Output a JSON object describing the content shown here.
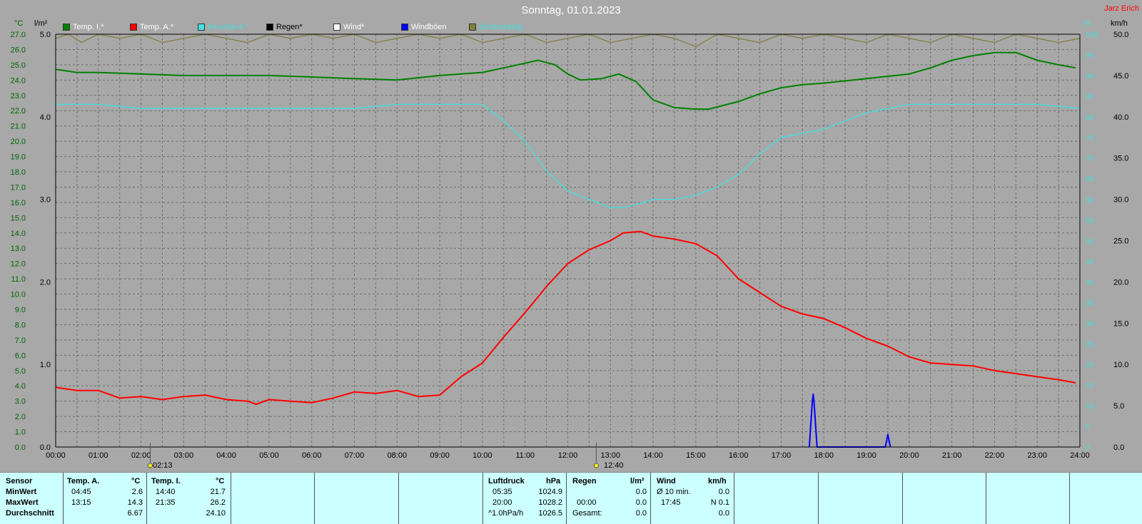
{
  "title": "Sonntag, 01.01.2023",
  "author": "Jarz Erich",
  "units": {
    "temp": "°C",
    "rain": "l/m²",
    "humidity": "%",
    "wind": "km/h"
  },
  "legend": [
    {
      "label": "Temp. I.*",
      "color": "#008000",
      "text_color": "#ffffff"
    },
    {
      "label": "Temp. A.*",
      "color": "#ff0000",
      "text_color": "#ffffff"
    },
    {
      "label": "Feuchte A.*",
      "color": "#40e0e0",
      "text_color": "#40e0e0"
    },
    {
      "label": "Regen*",
      "color": "#000000",
      "text_color": "#000000"
    },
    {
      "label": "Wind*",
      "color": "#ffffff",
      "text_color": "#ffffff"
    },
    {
      "label": "Windböen",
      "color": "#0000ff",
      "text_color": "#ffffff"
    },
    {
      "label": "Einstrahlung",
      "color": "#808040",
      "text_color": "#40e0e0"
    }
  ],
  "markers": {
    "sunrise": "02:13",
    "sunset": "12:40"
  },
  "chart_data": {
    "type": "line",
    "x_labels": [
      "00:00",
      "01:00",
      "02:00",
      "03:00",
      "04:00",
      "05:00",
      "06:00",
      "07:00",
      "08:00",
      "09:00",
      "10:00",
      "11:00",
      "12:00",
      "13:00",
      "14:00",
      "15:00",
      "16:00",
      "17:00",
      "18:00",
      "19:00",
      "20:00",
      "21:00",
      "22:00",
      "23:00",
      "24:00"
    ],
    "xlim": [
      0,
      24
    ],
    "axes": {
      "temp": {
        "min": 0.0,
        "max": 27.0,
        "step": 1.0
      },
      "rain": {
        "min": 0.0,
        "max": 5.0,
        "step": 1.0
      },
      "humidity": {
        "min": 0,
        "max": 100,
        "step": 5
      },
      "wind": {
        "min": 0.0,
        "max": 50.0,
        "step": 5.0
      }
    },
    "grid": true,
    "series": [
      {
        "name": "Temp. I.*",
        "axis": "temp",
        "color": "#008000",
        "x": [
          0,
          0.5,
          1,
          2,
          3,
          4,
          5,
          6,
          7,
          8,
          9,
          10,
          10.5,
          11,
          11.3,
          11.7,
          12,
          12.3,
          12.8,
          13.2,
          13.6,
          14,
          14.5,
          15,
          15.3,
          16,
          16.5,
          17,
          17.5,
          18,
          19,
          20,
          20.5,
          21,
          21.5,
          22,
          22.2,
          22.5,
          23,
          23.5,
          23.9
        ],
        "y": [
          24.7,
          24.5,
          24.5,
          24.4,
          24.3,
          24.3,
          24.3,
          24.2,
          24.1,
          24.0,
          24.3,
          24.5,
          24.8,
          25.1,
          25.3,
          25.0,
          24.4,
          24.0,
          24.1,
          24.4,
          23.9,
          22.7,
          22.2,
          22.1,
          22.1,
          22.6,
          23.1,
          23.5,
          23.7,
          23.8,
          24.1,
          24.4,
          24.8,
          25.3,
          25.6,
          25.8,
          25.8,
          25.8,
          25.3,
          25.0,
          24.8
        ]
      },
      {
        "name": "Temp. A.*",
        "axis": "temp",
        "color": "#ff0000",
        "x": [
          0,
          0.5,
          1,
          1.3,
          1.5,
          2,
          2.5,
          3,
          3.5,
          4,
          4.5,
          4.7,
          5,
          5.5,
          6,
          6.5,
          7,
          7.5,
          8,
          8.5,
          9,
          9.5,
          10,
          10.5,
          11,
          11.3,
          11.5,
          12,
          12.5,
          13,
          13.3,
          13.7,
          14,
          14.5,
          15,
          15.5,
          16,
          16.5,
          17,
          17.5,
          18,
          18.5,
          19,
          19.5,
          20,
          20.5,
          21,
          21.5,
          22,
          22.5,
          23,
          23.5,
          23.9
        ],
        "y": [
          3.9,
          3.7,
          3.7,
          3.4,
          3.2,
          3.3,
          3.1,
          3.3,
          3.4,
          3.1,
          3.0,
          2.8,
          3.1,
          3.0,
          2.9,
          3.2,
          3.6,
          3.5,
          3.7,
          3.3,
          3.4,
          4.6,
          5.5,
          7.2,
          8.8,
          9.8,
          10.5,
          12.0,
          12.9,
          13.5,
          14.0,
          14.1,
          13.8,
          13.6,
          13.3,
          12.5,
          11.0,
          10.1,
          9.2,
          8.7,
          8.4,
          7.8,
          7.1,
          6.6,
          5.9,
          5.5,
          5.4,
          5.3,
          5.0,
          4.8,
          4.6,
          4.4,
          4.2
        ]
      },
      {
        "name": "Feuchte A.*",
        "axis": "humidity",
        "color": "#40e0e0",
        "x": [
          0,
          1,
          2,
          3,
          4,
          5,
          6,
          7,
          8,
          9,
          10,
          10.5,
          11,
          11.5,
          12,
          12.5,
          13,
          13.3,
          13.7,
          14,
          14.5,
          15,
          15.5,
          16,
          16.5,
          17,
          17.5,
          18,
          19,
          20,
          20.5,
          21,
          22,
          23,
          24
        ],
        "y": [
          83,
          83,
          82,
          82,
          82,
          82,
          82,
          82,
          83,
          83,
          83,
          79,
          74,
          67,
          62,
          60,
          58,
          58,
          59,
          60,
          60,
          61,
          63,
          66,
          71,
          75,
          76,
          77,
          81,
          83,
          83,
          83,
          83,
          83,
          82
        ]
      },
      {
        "name": "Einstrahlung",
        "axis": "humidity",
        "color": "#808040",
        "x": [
          0,
          0.3,
          0.6,
          1,
          1.5,
          2,
          2.5,
          3,
          3.5,
          4,
          4.5,
          5,
          5.5,
          6,
          6.5,
          7,
          7.5,
          8,
          8.5,
          9,
          9.5,
          10,
          10.5,
          11,
          11.5,
          12,
          12.5,
          13,
          13.5,
          14,
          14.5,
          15,
          15.5,
          16,
          16.5,
          17,
          17.5,
          18,
          18.5,
          19,
          19.5,
          20,
          20.5,
          21,
          21.5,
          22,
          22.5,
          23,
          23.5,
          24
        ],
        "y": [
          99,
          100,
          98,
          100,
          99,
          100,
          98,
          99,
          100,
          99,
          98,
          100,
          99,
          100,
          99,
          100,
          98,
          99,
          100,
          99,
          100,
          98,
          99,
          100,
          98,
          99,
          100,
          98,
          99,
          100,
          99,
          97,
          100,
          99,
          98,
          100,
          99,
          100,
          99,
          98,
          100,
          99,
          98,
          100,
          99,
          98,
          100,
          99,
          98,
          99
        ]
      },
      {
        "name": "Windböen",
        "axis": "wind",
        "color": "#0000ff",
        "x": [
          17.66,
          17.73,
          17.75,
          17.77,
          17.84,
          19.44,
          19.5,
          19.56
        ],
        "y": [
          0,
          5.5,
          6.4,
          5.5,
          0,
          0,
          1.5,
          0
        ]
      }
    ]
  },
  "stats": {
    "sensor_label": "Sensor",
    "row_labels": [
      "MinWert",
      "MaxWert",
      "Durchschnitt"
    ],
    "temp_a": {
      "header": "Temp. A.",
      "unit": "°C",
      "min_time": "04:45",
      "min": "2.6",
      "max_time": "13:15",
      "max": "14.3",
      "avg": "6.67"
    },
    "temp_i": {
      "header": "Temp. I.",
      "unit": "°C",
      "min_time": "14:40",
      "min": "21.7",
      "max_time": "21:35",
      "max": "26.2",
      "avg": "24.10"
    },
    "pressure": {
      "header": "Luftdruck",
      "unit": "hPa",
      "r1_time": "05:35",
      "r1": "1024.9",
      "r2_time": "20:00",
      "r2": "1028.2",
      "r3_time": "^1.0hPa/h",
      "r3": "1026.5"
    },
    "rain": {
      "header": "Regen",
      "unit": "l/m²",
      "r2_time": "00:00",
      "r2": "0.0",
      "r3_time": "Gesamt:",
      "r3": "0.0",
      "r1": "0.0"
    },
    "wind": {
      "header": "Wind",
      "unit": "km/h",
      "r1_time": "Ø 10 min.",
      "r1": "0.0",
      "r2_time": "17:45",
      "r2": "N 0.1",
      "r3": "0.0"
    }
  }
}
